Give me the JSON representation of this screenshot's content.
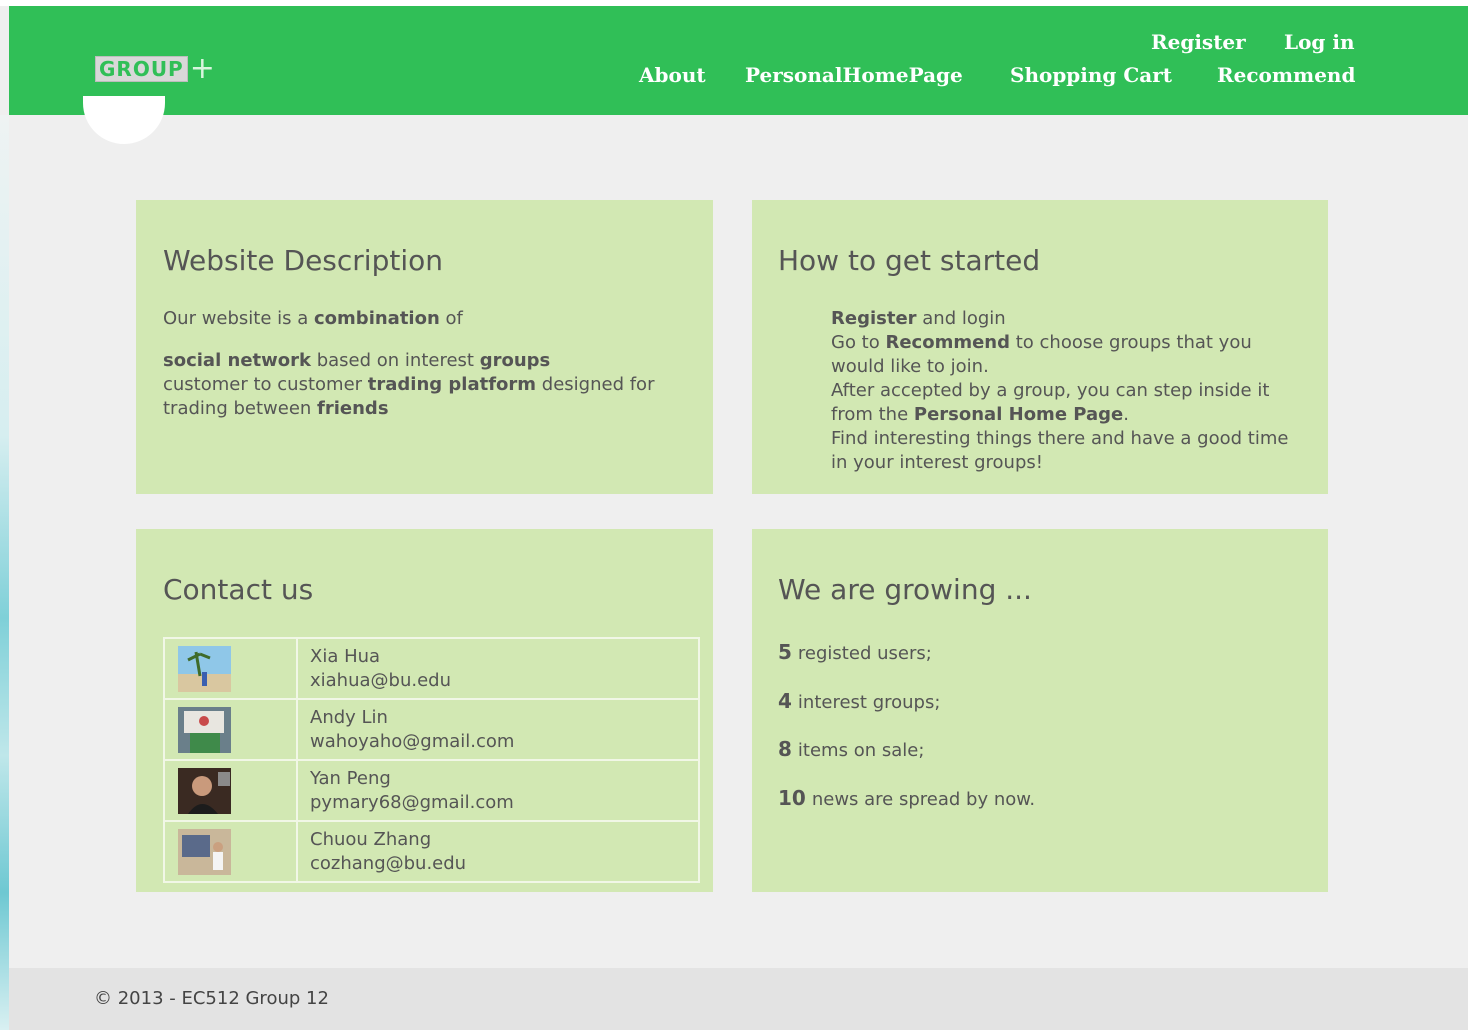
{
  "header": {
    "logo_text": "GROUP",
    "logo_plus": "+",
    "nav": {
      "register": "Register",
      "login": "Log in",
      "about": "About",
      "personal_home": "PersonalHomePage",
      "shopping_cart": "Shopping Cart",
      "recommend": "Recommend"
    }
  },
  "description": {
    "title": "Website Description",
    "line1_pre": "Our website is a ",
    "line1_bold": "combination",
    "line1_post": " of",
    "item1_bold1": "social network",
    "item1_mid": " based on interest ",
    "item1_bold2": "groups",
    "item2_pre": "customer to customer ",
    "item2_bold": "trading platform",
    "item2_post": " designed for",
    "item2_line2_pre": "trading between ",
    "item2_line2_bold": "friends"
  },
  "getting_started": {
    "title": "How to get started",
    "s1_bold": "Register",
    "s1_post": " and login",
    "s2_pre": "Go to ",
    "s2_bold": "Recommend",
    "s2_post": " to choose groups that you",
    "s2_line2": "would like to join.",
    "s3_line1": "After accepted by a group, you can step inside it",
    "s3_pre": "from the ",
    "s3_bold": "Personal Home Page",
    "s3_post": ".",
    "s4_line1": "Find interesting things there and have a good time",
    "s4_line2": "in your interest groups!"
  },
  "contact": {
    "title": "Contact us",
    "people": [
      {
        "name": "Xia Hua",
        "email": "xiahua@bu.edu"
      },
      {
        "name": "Andy Lin",
        "email": "wahoyaho@gmail.com"
      },
      {
        "name": "Yan Peng",
        "email": "pymary68@gmail.com"
      },
      {
        "name": "Chuou Zhang",
        "email": "cozhang@bu.edu"
      }
    ]
  },
  "growing": {
    "title": "We are growing ...",
    "stats": [
      {
        "num": "5",
        "label": "registed users;"
      },
      {
        "num": "4",
        "label": "interest groups;"
      },
      {
        "num": "8",
        "label": "items on sale;"
      },
      {
        "num": "10",
        "label": "news are spread by now."
      }
    ]
  },
  "footer": {
    "text": "© 2013 - EC512 Group 12"
  },
  "colors": {
    "header_green": "#30bf57",
    "panel_green": "#d2e8b3",
    "page_bg": "#efefef"
  }
}
